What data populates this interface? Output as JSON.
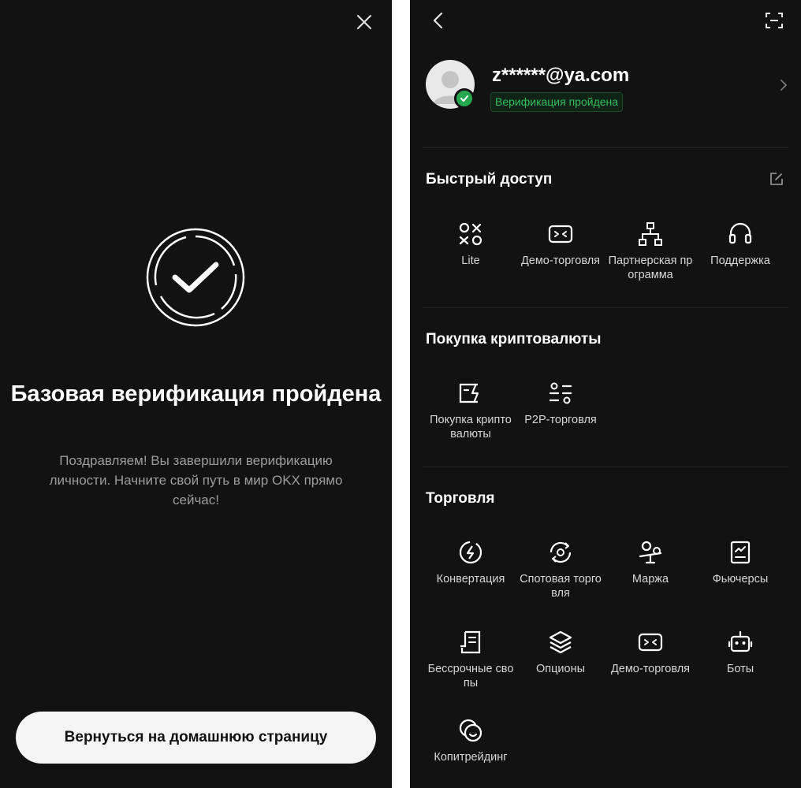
{
  "left": {
    "title": "Базовая верификация пройдена",
    "message": "Поздравляем! Вы завершили верификацию личности. Начните свой путь в мир OKX прямо сейчас!",
    "home_button": "Вернуться на домашнюю страницу"
  },
  "right": {
    "profile": {
      "email": "z******@ya.com",
      "status": "Верификация пройдена"
    },
    "quick_access": {
      "title": "Быстрый доступ",
      "items": [
        {
          "label": "Lite",
          "icon": "lite-icon"
        },
        {
          "label": "Демо-торговля",
          "icon": "demo-trading-icon"
        },
        {
          "label": "Партнерская программа",
          "icon": "affiliate-icon"
        },
        {
          "label": "Поддержка",
          "icon": "support-headset-icon"
        }
      ]
    },
    "buy_crypto": {
      "title": "Покупка криптовалюты",
      "items": [
        {
          "label": "Покупка криптовалюты",
          "icon": "buy-crypto-icon"
        },
        {
          "label": "P2P-торговля",
          "icon": "p2p-icon"
        }
      ]
    },
    "trading": {
      "title": "Торговля",
      "items": [
        {
          "label": "Конвертация",
          "icon": "convert-icon"
        },
        {
          "label": "Спотовая торговля",
          "icon": "spot-trading-icon"
        },
        {
          "label": "Маржа",
          "icon": "margin-icon"
        },
        {
          "label": "Фьючерсы",
          "icon": "futures-icon"
        },
        {
          "label": "Бессрочные свопы",
          "icon": "perpetual-swaps-icon"
        },
        {
          "label": "Опционы",
          "icon": "options-icon"
        },
        {
          "label": "Демо-торговля",
          "icon": "demo-trading-icon"
        },
        {
          "label": "Боты",
          "icon": "bots-icon"
        },
        {
          "label": "Копитрейдинг",
          "icon": "copy-trading-icon"
        }
      ]
    }
  },
  "colors": {
    "background": "#121212",
    "accent_green": "#2fbf5f",
    "muted_text": "#9c9c9c",
    "button_bg": "#f5f5f5"
  }
}
